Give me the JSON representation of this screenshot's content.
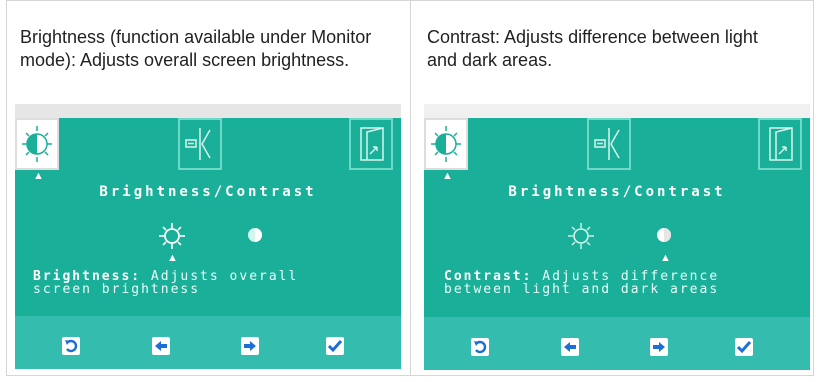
{
  "panels": [
    {
      "caption": "Brightness (function available under Monitor mode): Adjusts overall screen brightness.",
      "osd_title": "Brightness/Contrast",
      "desc_keyword": "Brightness:",
      "desc_line1": "Adjusts overall",
      "desc_line2": "screen brightness",
      "selected": "brightness"
    },
    {
      "caption": "Contrast: Adjusts difference between light and dark areas.",
      "osd_title": "Brightness/Contrast",
      "desc_keyword": "Contrast:",
      "desc_line1": "Adjusts difference",
      "desc_line2": "between light and dark areas",
      "selected": "contrast"
    }
  ],
  "icons": {
    "top": [
      "brightness-contrast-icon",
      "input-source-icon",
      "exit-icon"
    ],
    "sub": [
      "sun-icon",
      "half-moon-icon"
    ],
    "nav": [
      "back-icon",
      "left-arrow-icon",
      "right-arrow-icon",
      "check-icon"
    ]
  },
  "colors": {
    "screen": "#1aaf98",
    "bottom_bar": "#34bcae",
    "nav_icon": "#1b6fd6"
  }
}
